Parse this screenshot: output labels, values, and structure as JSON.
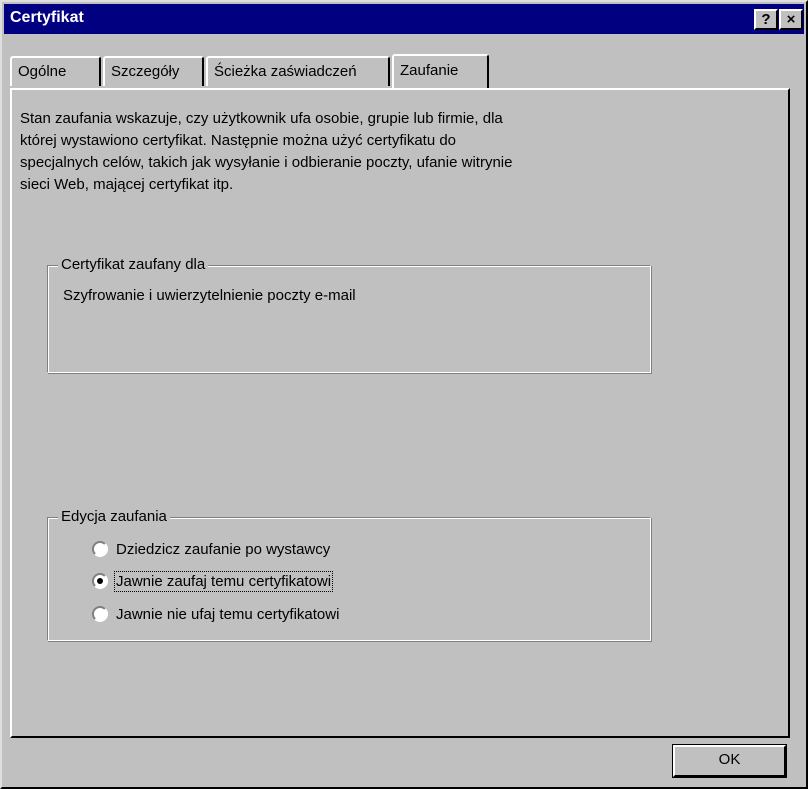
{
  "window": {
    "title": "Certyfikat",
    "help_label": "?",
    "close_label": "×"
  },
  "tabs": [
    {
      "label": "Ogólne",
      "active": false
    },
    {
      "label": "Szczegóły",
      "active": false
    },
    {
      "label": "Ścieżka zaświadczeń",
      "active": false
    },
    {
      "label": "Zaufanie",
      "active": true
    }
  ],
  "description": {
    "lines": [
      "Stan zaufania wskazuje, czy użytkownik ufa osobie, grupie lub firmie, dla",
      "której wystawiono certyfikat.  Następnie można użyć certyfikatu do",
      "specjalnych celów, takich jak wysyłanie i odbieranie poczty, ufanie witrynie",
      "sieci Web, mającej certyfikat itp."
    ]
  },
  "trusted_for": {
    "title": "Certyfikat zaufany dla",
    "items": [
      "Szyfrowanie i uwierzytelnienie poczty e-mail"
    ]
  },
  "trust_edit": {
    "title": "Edycja zaufania",
    "options": [
      {
        "label": "Dziedzicz zaufanie po wystawcy",
        "checked": false
      },
      {
        "label": "Jawnie zaufaj temu certyfikatowi",
        "checked": true
      },
      {
        "label": "Jawnie nie ufaj temu certyfikatowi",
        "checked": false
      }
    ]
  },
  "buttons": {
    "ok_label": "OK"
  }
}
